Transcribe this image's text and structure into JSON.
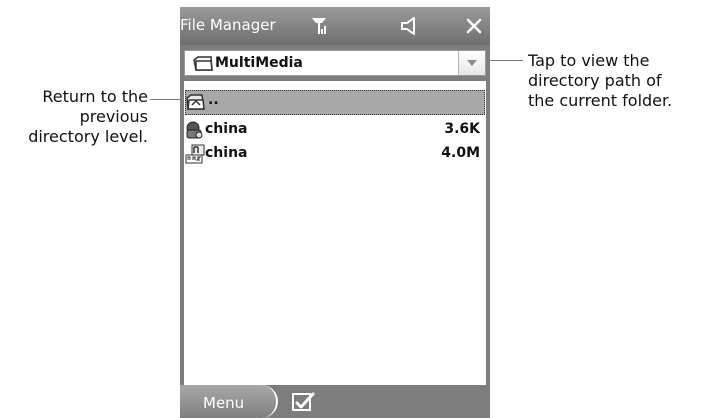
{
  "callouts": {
    "left": [
      "Return to the",
      "previous",
      "directory level."
    ],
    "right": [
      "Tap to view the",
      "directory path of",
      "the current folder."
    ]
  },
  "device": {
    "title": "File Manager",
    "icons": {
      "signal": "signal-icon",
      "sound": "speaker-icon",
      "close": "close-icon"
    },
    "path": {
      "label": "MultiMedia",
      "icon": "folder-icon",
      "dropdown": "chevron-down-icon"
    },
    "files": [
      {
        "name": "..",
        "size": "",
        "icon": "up-folder-icon"
      },
      {
        "name": "china",
        "size": "3.6K",
        "icon": "media-file-icon"
      },
      {
        "name": "china",
        "size": "4.0M",
        "icon": "mp3-file-icon"
      }
    ],
    "bottom": {
      "menu_label": "Menu",
      "check_icon": "checkbox-icon"
    }
  },
  "colors": {
    "device_gray": "#7d7d7d",
    "highlight_gray": "#a8a8a8",
    "text": "#111111",
    "white": "#ffffff"
  }
}
